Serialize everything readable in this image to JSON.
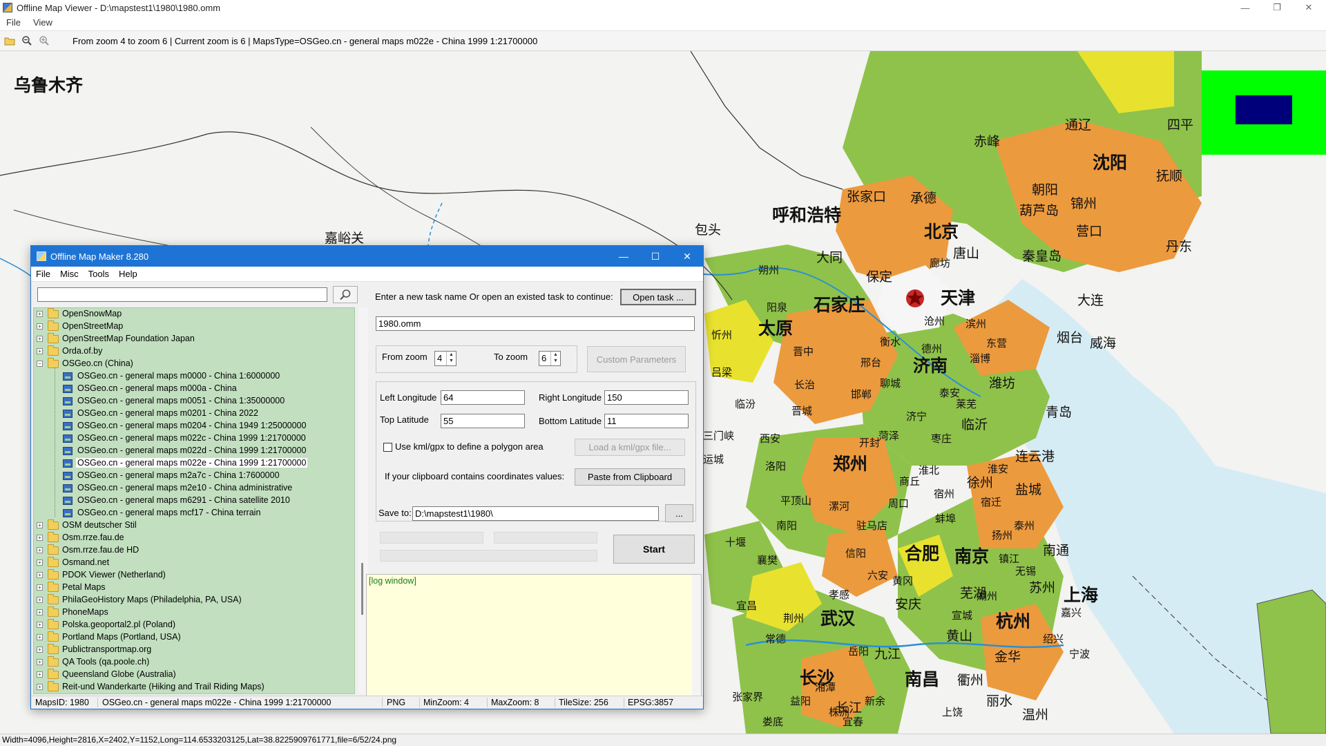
{
  "window": {
    "title": "Offline Map Viewer - D:\\mapstest1\\1980\\1980.omm"
  },
  "menubar": [
    "File",
    "View"
  ],
  "toolbar": {
    "info": "From zoom 4 to zoom 6   |   Current zoom is 6 |   MapsType=OSGeo.cn - general maps m022e - China 1999 1:21700000"
  },
  "map": {
    "labels": [
      "乌鲁木齐",
      "呼和浩特",
      "北京",
      "天津",
      "石家庄",
      "太原",
      "济南",
      "郑州",
      "合肥",
      "南京",
      "武汉",
      "长沙",
      "南昌",
      "杭州",
      "上海",
      "沈阳",
      "承德",
      "张家口",
      "大同",
      "保定",
      "唐山",
      "秦皇岛",
      "大连",
      "烟台",
      "威海",
      "青岛",
      "潍坊",
      "临沂",
      "徐州",
      "连云港",
      "盐城",
      "南通",
      "苏州",
      "芜湖",
      "安庆",
      "九江",
      "黄山",
      "金华",
      "衢州",
      "温州",
      "丽水",
      "包头",
      "嘉峪关",
      "朔州",
      "阳泉",
      "晋中",
      "长治",
      "晋城",
      "邯郸",
      "邢台",
      "衡水",
      "德州",
      "聊城",
      "泰安",
      "莱芜",
      "菏泽",
      "商丘",
      "开封",
      "洛阳",
      "平顶山",
      "南阳",
      "信阳",
      "漯河",
      "周口",
      "驻马店",
      "十堰",
      "襄樊",
      "宜昌",
      "荆州",
      "孝感",
      "黄冈",
      "岳阳",
      "常德",
      "张家界",
      "益阳",
      "娄底",
      "湘潭",
      "株洲",
      "新余",
      "宜春",
      "上饶",
      "赤峰",
      "朝阳",
      "葫芦岛",
      "锦州",
      "营口",
      "抚顺",
      "四平",
      "通辽",
      "丹东",
      "廊坊",
      "沧州",
      "滨州",
      "东营",
      "淄博",
      "枣庄",
      "济宁",
      "宿州",
      "淮北",
      "蚌埠",
      "六安",
      "宿迁",
      "淮安",
      "扬州",
      "泰州",
      "镇江",
      "无锡",
      "宣城",
      "湖州",
      "嘉兴",
      "绍兴",
      "宁波",
      "三门峡",
      "西安",
      "忻州",
      "吕梁",
      "临汾",
      "运城",
      "黄河",
      "长江"
    ],
    "overview": {
      "frame_color": "#00ff00",
      "view_color": "#00007a"
    }
  },
  "statusbar": "Width=4096,Height=2816,X=2402,Y=1152,Long=114.6533203125,Lat=38.8225909761771,file=6/52/24.png",
  "dialog": {
    "title": "Offline Map Maker 8.280",
    "menu": [
      "File",
      "Misc",
      "Tools",
      "Help"
    ],
    "search": {
      "value": "",
      "placeholder": ""
    },
    "tree": [
      {
        "label": "OpenSnowMap",
        "type": "folder"
      },
      {
        "label": "OpenStreetMap",
        "type": "folder"
      },
      {
        "label": "OpenStreetMap Foundation Japan",
        "type": "folder"
      },
      {
        "label": "Orda.of.by",
        "type": "folder"
      },
      {
        "label": "OSGeo.cn (China)",
        "type": "folder-open"
      },
      {
        "label": "OSGeo.cn - general maps m0000 - China 1:6000000",
        "type": "child"
      },
      {
        "label": "OSGeo.cn - general maps m000a - China",
        "type": "child"
      },
      {
        "label": "OSGeo.cn - general maps m0051 - China 1:35000000",
        "type": "child"
      },
      {
        "label": "OSGeo.cn - general maps m0201 - China 2022",
        "type": "child"
      },
      {
        "label": "OSGeo.cn - general maps m0204 - China 1949 1:25000000",
        "type": "child"
      },
      {
        "label": "OSGeo.cn - general maps m022c - China 1999 1:21700000",
        "type": "child"
      },
      {
        "label": "OSGeo.cn - general maps m022d - China 1999 1:21700000",
        "type": "child"
      },
      {
        "label": "OSGeo.cn - general maps m022e - China 1999 1:21700000",
        "type": "child-selected"
      },
      {
        "label": "OSGeo.cn - general maps m2a7c - China 1:7600000",
        "type": "child"
      },
      {
        "label": "OSGeo.cn - general maps m2e10 - China administrative",
        "type": "child"
      },
      {
        "label": "OSGeo.cn - general maps m6291 - China satellite 2010",
        "type": "child"
      },
      {
        "label": "OSGeo.cn - general maps mcf17 - China terrain",
        "type": "child"
      },
      {
        "label": "OSM deutscher Stil",
        "type": "folder"
      },
      {
        "label": "Osm.rrze.fau.de",
        "type": "folder"
      },
      {
        "label": "Osm.rrze.fau.de HD",
        "type": "folder"
      },
      {
        "label": "Osmand.net",
        "type": "folder"
      },
      {
        "label": "PDOK Viewer (Netherland)",
        "type": "folder"
      },
      {
        "label": "Petal Maps",
        "type": "folder"
      },
      {
        "label": "PhilaGeoHistory Maps (Philadelphia, PA, USA)",
        "type": "folder"
      },
      {
        "label": "PhoneMaps",
        "type": "folder"
      },
      {
        "label": "Polska.geoportal2.pl (Poland)",
        "type": "folder"
      },
      {
        "label": "Portland Maps (Portland, USA)",
        "type": "folder"
      },
      {
        "label": "Publictransportmap.org",
        "type": "folder"
      },
      {
        "label": "QA Tools (qa.poole.ch)",
        "type": "folder"
      },
      {
        "label": "Queensland Globe (Australia)",
        "type": "folder"
      },
      {
        "label": "Reit-und Wanderkarte (Hiking and Trail Riding Maps)",
        "type": "folder"
      }
    ],
    "task": {
      "prompt": "Enter a new task name Or open an existed task to continue:",
      "open_button": "Open task ...",
      "task_name": "1980.omm"
    },
    "zoom": {
      "from_label": "From zoom",
      "from_value": "4",
      "to_label": "To zoom",
      "to_value": "6",
      "custom_button": "Custom Parameters"
    },
    "area": {
      "left_lon_label": "Left Longitude",
      "left_lon": "64",
      "right_lon_label": "Right Longitude",
      "right_lon": "150",
      "top_lat_label": "Top Latitude",
      "top_lat": "55",
      "bottom_lat_label": "Bottom Latitude",
      "bottom_lat": "11",
      "kml_label": "Use kml/gpx to define a polygon area",
      "kml_checked": false,
      "kml_button": "Load a kml/gpx file...",
      "clipboard_label": "If your clipboard contains coordinates values:",
      "clipboard_button": "Paste from Clipboard"
    },
    "save": {
      "label": "Save to:",
      "path": "D:\\mapstest1\\1980\\",
      "browse": "..."
    },
    "start_button": "Start",
    "log": "[log window]",
    "status": {
      "maps_id": "MapsID: 1980",
      "maps_name": "OSGeo.cn - general maps m022e - China 1999 1:21700000",
      "format": "PNG",
      "min_zoom": "MinZoom: 4",
      "max_zoom": "MaxZoom: 8",
      "tile_size": "TileSize: 256",
      "epsg": "EPSG:3857"
    }
  }
}
